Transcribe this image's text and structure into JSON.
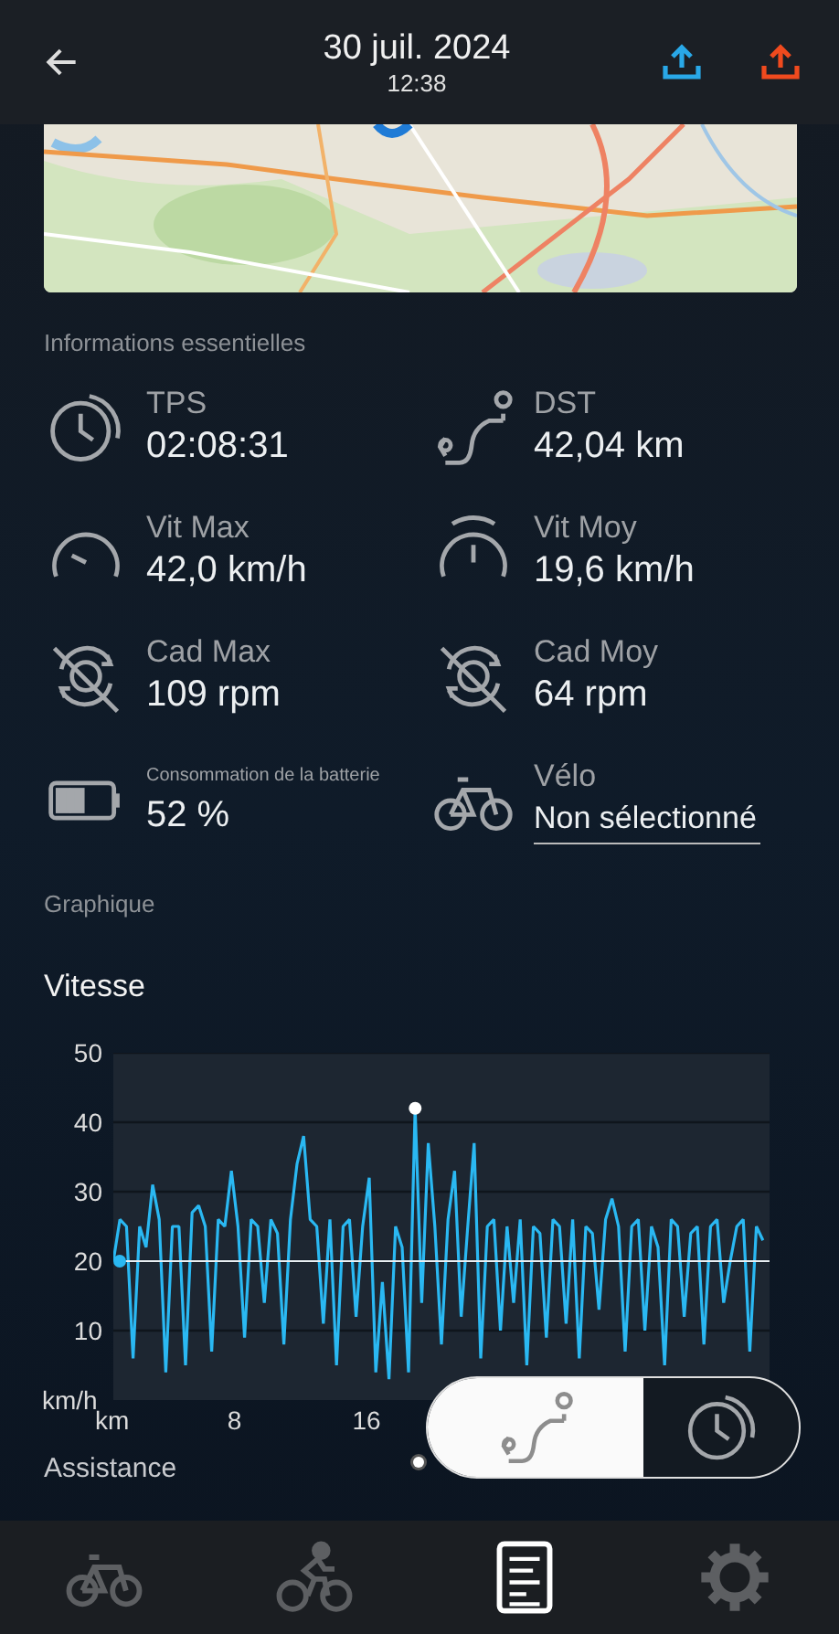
{
  "header": {
    "date": "30 juil. 2024",
    "time": "12:38",
    "actions": [
      {
        "kind": "upload",
        "color": "#29a8e8"
      },
      {
        "kind": "upload",
        "color": "#f04a1e"
      }
    ]
  },
  "info": {
    "title": "Informations essentielles",
    "stats": [
      {
        "kind": "time",
        "label": "TPS",
        "value": "02:08:31"
      },
      {
        "kind": "distance",
        "label": "DST",
        "value": "42,04 km"
      },
      {
        "kind": "max-speed",
        "label": "Vit Max",
        "value": "42,0 km/h"
      },
      {
        "kind": "avg-speed",
        "label": "Vit Moy",
        "value": "19,6 km/h"
      },
      {
        "kind": "cadence",
        "label": "Cad Max",
        "value": "109 rpm"
      },
      {
        "kind": "cadence",
        "label": "Cad Moy",
        "value": "64 rpm"
      },
      {
        "kind": "battery",
        "label": "Consommation de la batterie",
        "value": "52 %"
      },
      {
        "kind": "bike",
        "label": "Vélo",
        "value": "Non sélectionné"
      }
    ]
  },
  "graph": {
    "title": "Graphique",
    "chart_data": {
      "type": "line",
      "title": "Vitesse",
      "ylabel": "km/h",
      "xlim": [
        0,
        42
      ],
      "ylim": [
        0,
        50
      ],
      "yticks": [
        10,
        20,
        30,
        40,
        50
      ],
      "xticks": [
        {
          "value": 0,
          "label": "km"
        },
        8,
        16
      ],
      "grid": true,
      "x": [
        0,
        0.42,
        0.84,
        1.26,
        1.68,
        2.1,
        2.52,
        2.94,
        3.36,
        3.78,
        4.2,
        4.62,
        5.04,
        5.46,
        5.88,
        6.3,
        6.72,
        7.14,
        7.56,
        7.98,
        8.4,
        8.82,
        9.24,
        9.66,
        10.08,
        10.5,
        10.92,
        11.34,
        11.76,
        12.18,
        12.6,
        13.02,
        13.44,
        13.86,
        14.28,
        14.7,
        15.12,
        15.54,
        15.96,
        16.38,
        16.8,
        17.22,
        17.64,
        18.06,
        18.48,
        18.9,
        19.32,
        19.74,
        20.16,
        20.58,
        21,
        21.42,
        21.84,
        22.26,
        22.68,
        23.1,
        23.52,
        23.94,
        24.36,
        24.78,
        25.2,
        25.62,
        26.04,
        26.46,
        26.88,
        27.3,
        27.72,
        28.14,
        28.56,
        28.98,
        29.4,
        29.82,
        30.24,
        30.66,
        31.08,
        31.5,
        31.92,
        32.34,
        32.76,
        33.18,
        33.6,
        34.02,
        34.44,
        34.86,
        35.28,
        35.7,
        36.12,
        36.54,
        36.96,
        37.38,
        37.8,
        38.22,
        38.64,
        39.06,
        39.48,
        39.9,
        40.32,
        40.74,
        41.16,
        41.58
      ],
      "series": [
        {
          "color": "#2ab8f2",
          "values": [
            20,
            26,
            25,
            6,
            25,
            22,
            31,
            26,
            4,
            25,
            25,
            5,
            27,
            28,
            25,
            7,
            26,
            25,
            33,
            25,
            9,
            26,
            25,
            14,
            26,
            24,
            8,
            26,
            34,
            38,
            26,
            25,
            11,
            26,
            5,
            25,
            26,
            12,
            25,
            32,
            4,
            17,
            3,
            25,
            22,
            4,
            42,
            14,
            37,
            25,
            8,
            26,
            33,
            12,
            25,
            37,
            6,
            25,
            26,
            10,
            25,
            14,
            26,
            5,
            25,
            24,
            9,
            26,
            25,
            11,
            26,
            6,
            25,
            24,
            13,
            26,
            29,
            25,
            7,
            25,
            26,
            10,
            25,
            22,
            5,
            26,
            25,
            12,
            24,
            25,
            8,
            25,
            26,
            14,
            20,
            25,
            26,
            7,
            25,
            23
          ]
        }
      ],
      "ref_lines": [
        {
          "axis": "y",
          "value": 20,
          "color": "#e8eef2"
        }
      ]
    }
  },
  "mode_toggle": [
    {
      "kind": "route",
      "selected": true
    },
    {
      "kind": "time",
      "selected": false
    }
  ],
  "next_section": "Assistance",
  "nav": [
    {
      "kind": "bike",
      "selected": false
    },
    {
      "kind": "cyclist",
      "selected": false
    },
    {
      "kind": "document",
      "selected": true
    },
    {
      "kind": "settings",
      "selected": false
    }
  ]
}
